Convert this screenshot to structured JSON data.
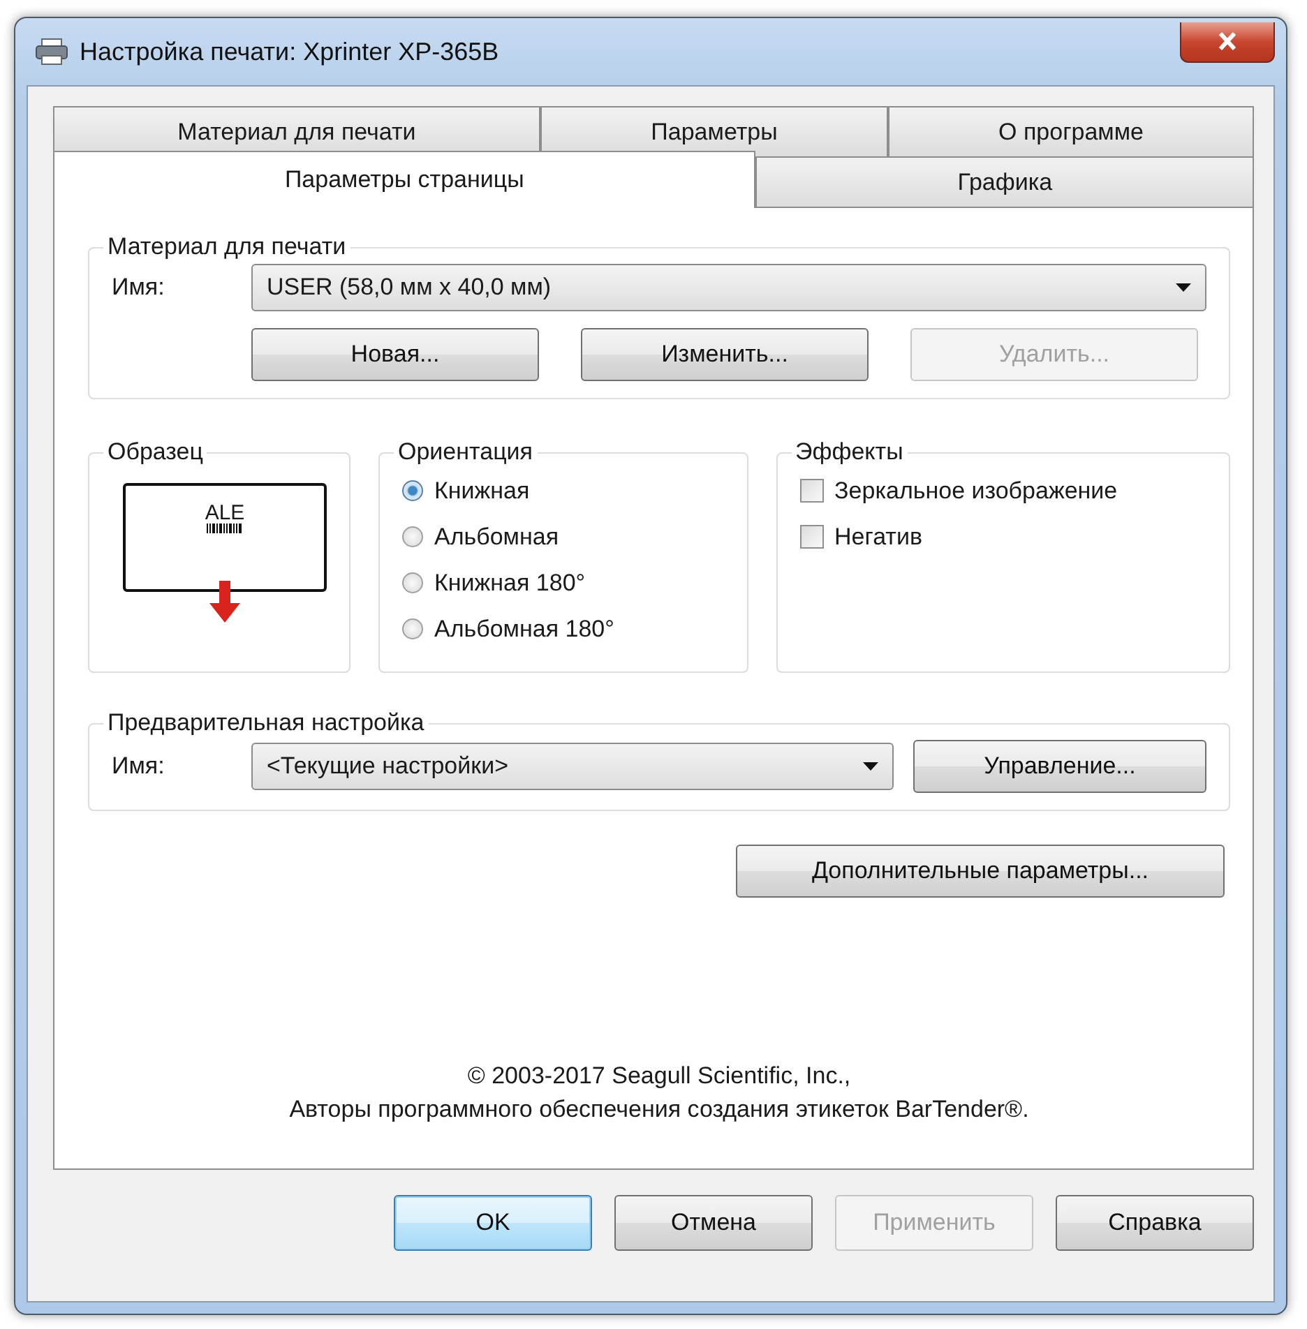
{
  "window": {
    "title": "Настройка печати: Xprinter XP-365B"
  },
  "tab_rows": [
    [
      {
        "label": "Материал для печати",
        "selected": false
      },
      {
        "label": "Параметры",
        "selected": false
      },
      {
        "label": "О программе",
        "selected": false
      }
    ],
    [
      {
        "label": "Параметры страницы",
        "selected": true
      },
      {
        "label": "Графика",
        "selected": false
      }
    ]
  ],
  "material": {
    "title": "Материал для печати",
    "name_label": "Имя:",
    "value": "USER (58,0 мм x 40,0 мм)",
    "buttons": [
      {
        "label": "Новая...",
        "disabled": false
      },
      {
        "label": "Изменить...",
        "disabled": false
      },
      {
        "label": "Удалить...",
        "disabled": true
      }
    ]
  },
  "sample": {
    "title": "Образец",
    "label": "ALE"
  },
  "orientation": {
    "title": "Ориентация",
    "options": [
      {
        "label": "Книжная",
        "selected": true
      },
      {
        "label": "Альбомная",
        "selected": false
      },
      {
        "label": "Книжная 180°",
        "selected": false
      },
      {
        "label": "Альбомная 180°",
        "selected": false
      }
    ]
  },
  "effects": {
    "title": "Эффекты",
    "options": [
      {
        "label": "Зеркальное изображение",
        "checked": false
      },
      {
        "label": "Негатив",
        "checked": false
      }
    ]
  },
  "preset": {
    "title": "Предварительная настройка",
    "name_label": "Имя:",
    "value": "<Текущие настройки>",
    "button": "Управление..."
  },
  "advanced_button": "Дополнительные параметры...",
  "copyright": [
    "© 2003-2017 Seagull Scientific, Inc.,",
    "Авторы программного обеспечения создания этикеток BarTender®."
  ],
  "footer_buttons": [
    {
      "label": "OK",
      "disabled": false,
      "default": true
    },
    {
      "label": "Отмена",
      "disabled": false,
      "default": false
    },
    {
      "label": "Применить",
      "disabled": true,
      "default": false
    },
    {
      "label": "Справка",
      "disabled": false,
      "default": false
    }
  ]
}
